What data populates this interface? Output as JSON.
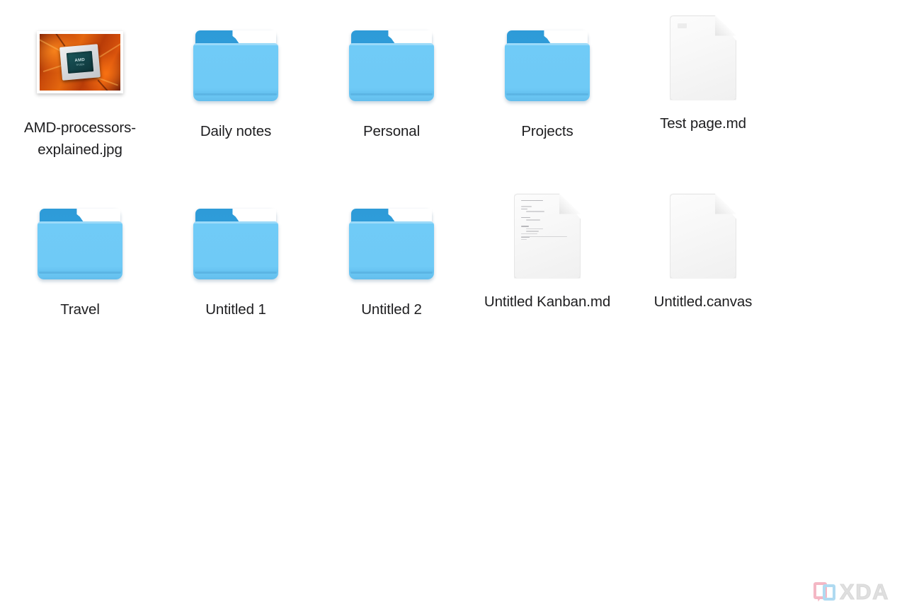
{
  "window": {
    "background_color": "#ffffff",
    "view_mode": "icon-grid"
  },
  "grid": {
    "columns": 5,
    "rows": 2,
    "items": [
      {
        "name": "AMD-processors-explained.jpg",
        "icon": "image-thumbnail-icon",
        "kind": "image",
        "thumbnail_subject": "AMD processor chip on orange background",
        "thumbnail_text": "AMD",
        "thumbnail_subtext": "RYZEN",
        "row": 1,
        "column": 1
      },
      {
        "name": "Daily notes",
        "icon": "folder-icon",
        "kind": "folder",
        "row": 1,
        "column": 2
      },
      {
        "name": "Personal",
        "icon": "folder-icon",
        "kind": "folder",
        "row": 1,
        "column": 3
      },
      {
        "name": "Projects",
        "icon": "folder-icon",
        "kind": "folder",
        "row": 1,
        "column": 4
      },
      {
        "name": "Test page.md",
        "icon": "document-icon",
        "kind": "markdown-document",
        "row": 1,
        "column": 5
      },
      {
        "name": "Travel",
        "icon": "folder-icon",
        "kind": "folder",
        "row": 2,
        "column": 1
      },
      {
        "name": "Untitled 1",
        "icon": "folder-icon",
        "kind": "folder",
        "row": 2,
        "column": 2
      },
      {
        "name": "Untitled 2",
        "icon": "folder-icon",
        "kind": "folder",
        "row": 2,
        "column": 3
      },
      {
        "name": "Untitled Kanban.md",
        "icon": "document-preview-icon",
        "kind": "markdown-document",
        "row": 2,
        "column": 4
      },
      {
        "name": "Untitled.canvas",
        "icon": "document-icon",
        "kind": "canvas-document",
        "row": 2,
        "column": 5
      }
    ]
  },
  "colors": {
    "folder_front": "#6fcaf6",
    "folder_back": "#2f9ddb",
    "document_page": "#f7f7f7",
    "label_text": "#1d1d1f",
    "background": "#ffffff"
  },
  "watermark": {
    "text": "XDA",
    "icon": "xda-speech-bubble-icon",
    "color_left": "#f2a8b8",
    "color_right": "#9ed2ef"
  }
}
